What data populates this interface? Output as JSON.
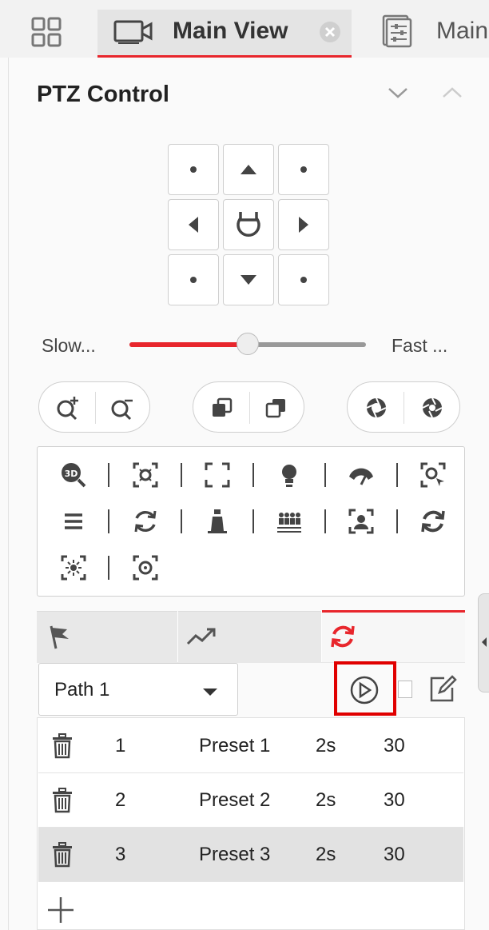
{
  "tabs": {
    "main_view_label": "Main View",
    "second_tab_label": "Main"
  },
  "panel": {
    "title": "PTZ Control"
  },
  "speed": {
    "slow_label": "Slow...",
    "fast_label": "Fast ...",
    "level": 0.5
  },
  "path": {
    "selected": "Path 1"
  },
  "patrol_list": [
    {
      "index": "1",
      "preset": "Preset 1",
      "duration": "2s",
      "speed": "30",
      "selected": false
    },
    {
      "index": "2",
      "preset": "Preset 2",
      "duration": "2s",
      "speed": "30",
      "selected": false
    },
    {
      "index": "3",
      "preset": "Preset 3",
      "duration": "2s",
      "speed": "30",
      "selected": true
    }
  ],
  "colors": {
    "accent": "#e8262c",
    "highlight_box": "#e00000"
  }
}
